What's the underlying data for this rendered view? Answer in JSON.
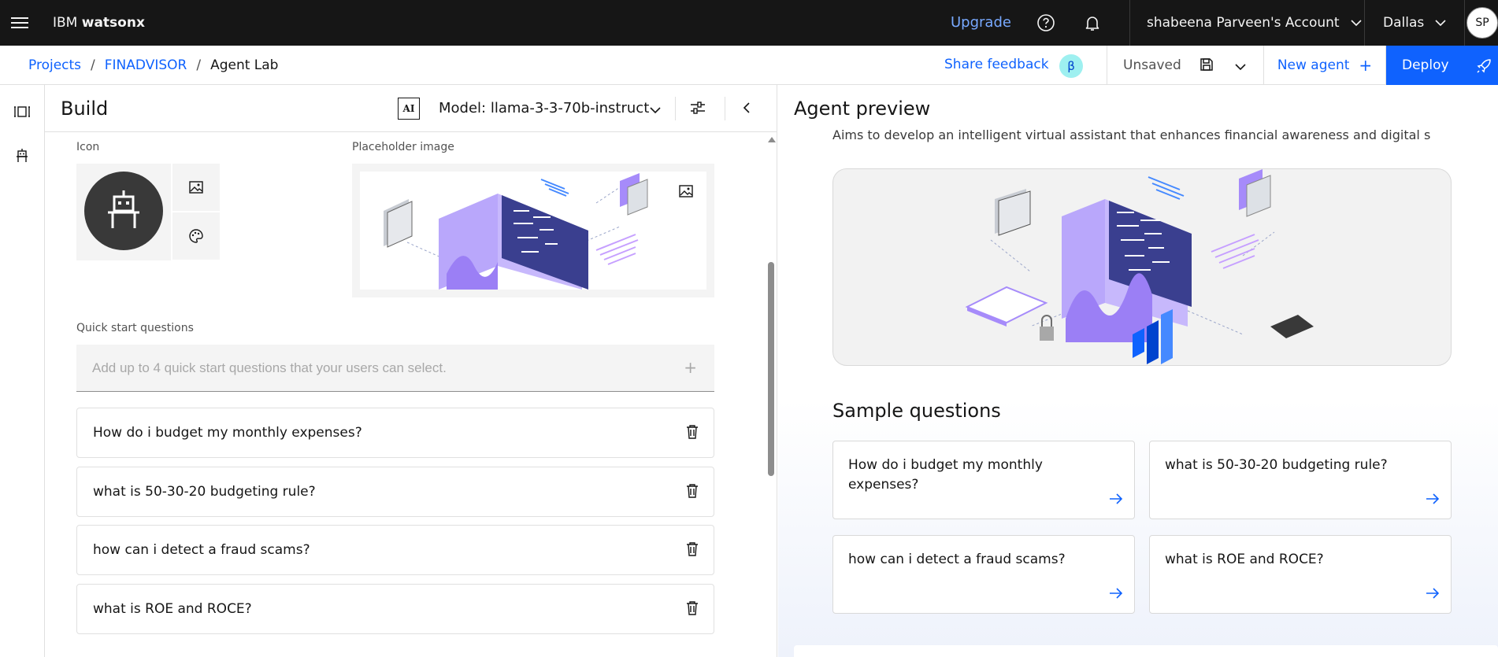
{
  "topbar": {
    "brand_prefix": "IBM",
    "brand_name": "watsonx",
    "upgrade_label": "Upgrade",
    "account_label": "shabeena Parveen's Account",
    "region_label": "Dallas",
    "avatar_initials": "SP"
  },
  "subbar": {
    "breadcrumb": [
      "Projects",
      "FINADVISOR",
      "Agent Lab"
    ],
    "share_feedback_label": "Share feedback",
    "beta_label": "β",
    "save_status": "Unsaved",
    "new_agent_label": "New agent",
    "deploy_label": "Deploy"
  },
  "build": {
    "title": "Build",
    "ai_badge": "AI",
    "model_label": "Model: llama-3-3-70b-instruct",
    "icon_label": "Icon",
    "placeholder_image_label": "Placeholder image",
    "quick_start_label": "Quick start questions",
    "quick_start_placeholder": "Add up to 4 quick start questions that your users can select.",
    "questions": [
      "How do i budget my monthly expenses?",
      "what is 50-30-20 budgeting rule?",
      "how can i detect a fraud scams?",
      "what is ROE and ROCE?"
    ]
  },
  "preview": {
    "title": "Agent preview",
    "description": "Aims to develop an intelligent virtual assistant that enhances financial awareness and digital safe",
    "sample_questions_title": "Sample questions",
    "sample_questions": [
      "How do i budget my monthly expenses?",
      "what is 50-30-20 budgeting rule?",
      "how can i detect a fraud scams?",
      "what is ROE and ROCE?"
    ]
  },
  "colors": {
    "accent": "#0f62fe",
    "topbar_bg": "#161616",
    "upgrade_link": "#78a9ff",
    "illustration_purple": "#a68bfa",
    "illustration_navy": "#3a3f8f"
  },
  "icons": [
    "hamburger-menu-icon",
    "help-icon",
    "notification-bell-icon",
    "chevron-down-icon",
    "save-icon",
    "plus-icon",
    "rocket-icon",
    "panel-icon",
    "agent-icon",
    "settings-sliders-icon",
    "chevron-left-icon",
    "robot-icon",
    "image-icon",
    "palette-icon",
    "trash-icon",
    "arrow-right-icon"
  ]
}
